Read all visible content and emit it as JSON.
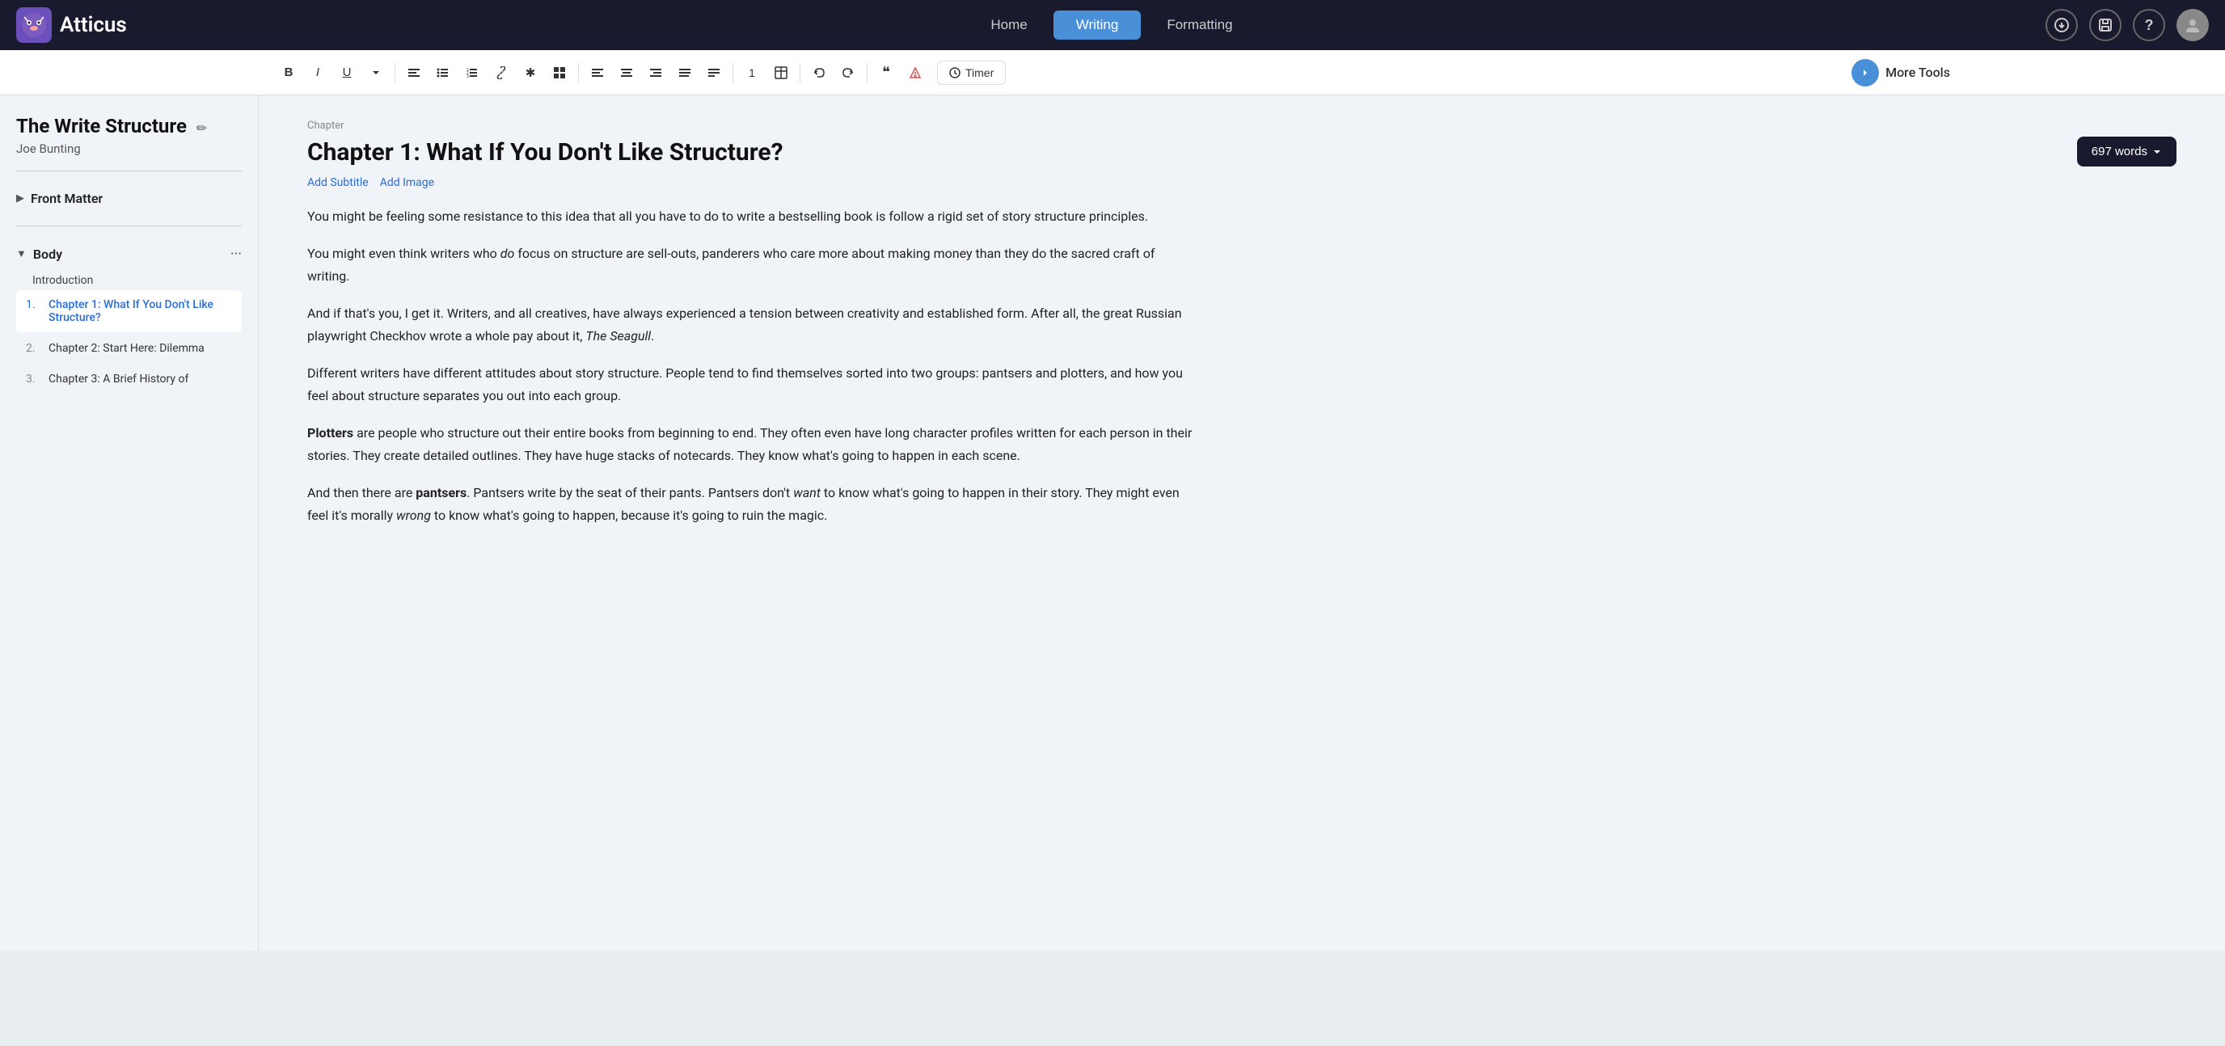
{
  "app": {
    "name": "Atticus",
    "logo_emoji": "🦊"
  },
  "nav": {
    "home_label": "Home",
    "writing_label": "Writing",
    "formatting_label": "Formatting",
    "active_tab": "Writing"
  },
  "toolbar": {
    "bold": "B",
    "italic": "I",
    "underline": "U",
    "dropdown": "∨",
    "align_left": "≡",
    "bullet_list": "≔",
    "numbered_list": "≣",
    "link": "🔗",
    "asterisk": "✱",
    "grid": "⊞",
    "align_center": "≡",
    "align_right": "≡",
    "align_justify": "≡",
    "align_full": "≡",
    "align_bottom": "≡",
    "number": "1",
    "table": "⊟",
    "undo": "↩",
    "redo": "↪",
    "quote": "❝",
    "alert": "⚠",
    "timer_label": "Timer",
    "more_tools_label": "More Tools"
  },
  "sidebar": {
    "book_title": "The Write Structure",
    "book_author": "Joe Bunting",
    "front_matter_label": "Front Matter",
    "body_label": "Body",
    "introduction_label": "Introduction",
    "chapters": [
      {
        "num": "1.",
        "name": "Chapter 1: What If You Don't Like Structure?",
        "active": true
      },
      {
        "num": "2.",
        "name": "Chapter 2: Start Here: Dilemma",
        "active": false
      },
      {
        "num": "3.",
        "name": "Chapter 3: A Brief History of",
        "active": false
      }
    ]
  },
  "editor": {
    "chapter_label": "Chapter",
    "chapter_title": "Chapter 1: What If You Don't Like Structure?",
    "word_count": "697 words",
    "add_subtitle": "Add Subtitle",
    "add_image": "Add Image",
    "paragraphs": [
      {
        "id": "p1",
        "html": "You might be feeling some resistance to this idea that all you have to do to write a bestselling book is follow a rigid set of story structure principles."
      },
      {
        "id": "p2",
        "html": "You might even think writers who <em>do</em> focus on structure are sell-outs, panderers who care more about making money than they do the sacred craft of writing."
      },
      {
        "id": "p3",
        "html": "And if that's you, I get it. Writers, and all creatives, have always experienced a tension between creativity and established form. After all, the great Russian playwright Checkhov wrote a whole pay about it, <em>The Seagull</em>."
      },
      {
        "id": "p4",
        "html": "Different writers have different attitudes about story structure. People tend to find themselves sorted into two groups: pantsers and plotters, and how you feel about structure separates you out into each group."
      },
      {
        "id": "p5",
        "html": "<strong>Plotters</strong> are people who structure out their entire books from beginning to end. They often even have long character profiles written for each person in their stories. They create detailed outlines. They have huge stacks of notecards. They know what's going to happen in each scene."
      },
      {
        "id": "p6",
        "html": "And then there are <strong>pantsers</strong>. Pantsers write by the seat of their pants. Pantsers don't <em>want</em> to know what's going to happen in their story. They might even feel it's morally <em>wrong</em> to know what's going to happen, because it's going to ruin the magic."
      }
    ]
  }
}
